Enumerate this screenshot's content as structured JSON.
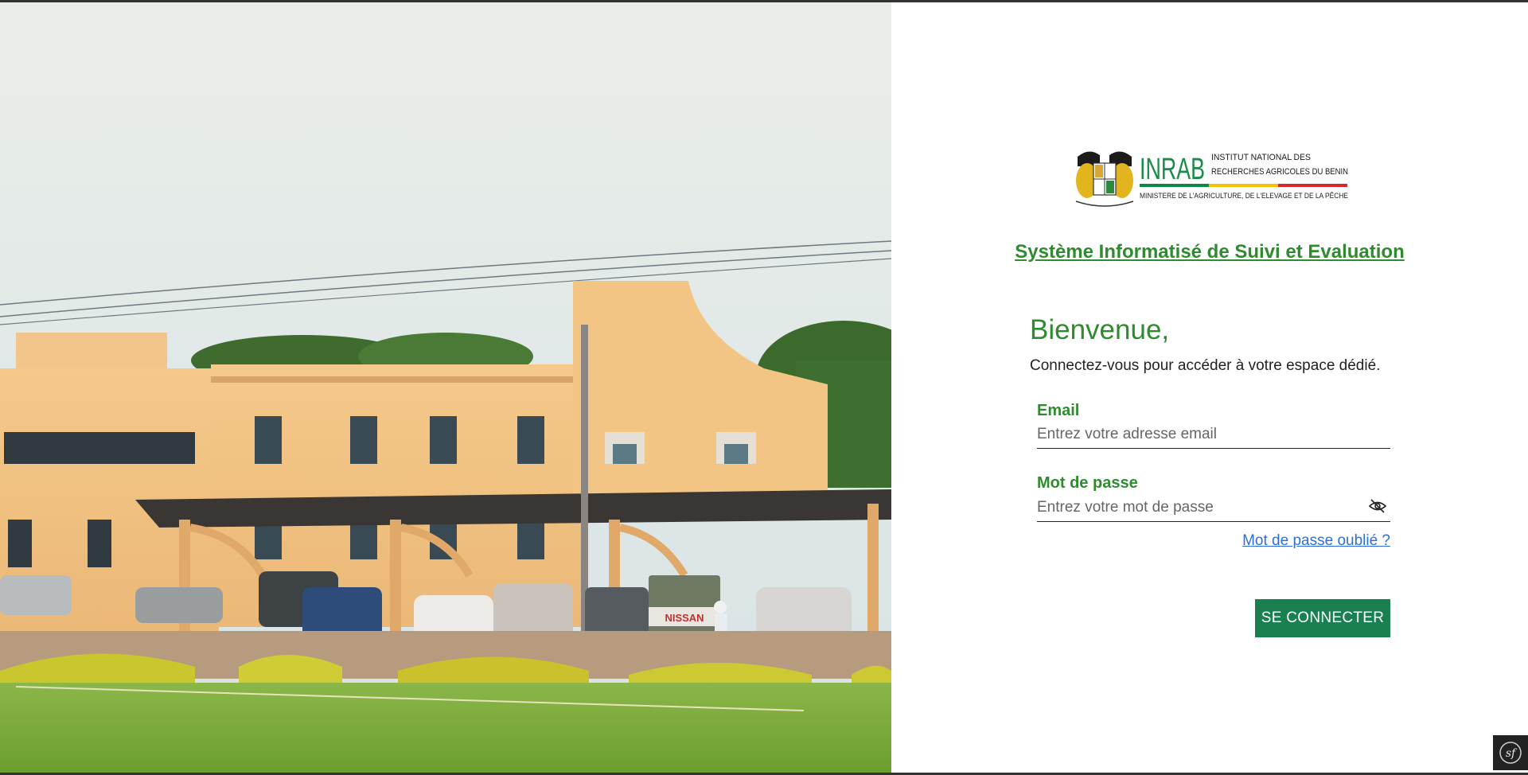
{
  "logo": {
    "acronym": "INRAB",
    "line1": "INSTITUT NATIONAL DES",
    "line2": "RECHERCHES AGRICOLES DU BENIN",
    "ministry": "MINISTERE DE L'AGRICULTURE, DE L'ELEVAGE  ET DE LA PÊCHE",
    "colors": {
      "green": "#0e8a47",
      "yellow": "#f2c400",
      "red": "#d62828"
    }
  },
  "app_title": "Système Informatisé de Suivi et Evaluation",
  "welcome": {
    "heading": "Bienvenue,",
    "subtitle": "Connectez-vous pour accéder à votre espace dédié."
  },
  "form": {
    "email_label": "Email",
    "email_placeholder": "Entrez votre adresse email",
    "password_label": "Mot de passe",
    "password_placeholder": "Entrez votre mot de passe",
    "toggle_icon": "eye-slash-icon",
    "forgot_link": "Mot de passe oublié ?",
    "submit_label": "SE CONNECTER"
  },
  "photo": {
    "truck_text": "NISSAN"
  },
  "colors": {
    "brand_green": "#2e8b2e",
    "button_green": "#1a8050",
    "link_blue": "#2a6fdb"
  },
  "toolbar": {
    "icon": "symfony-icon",
    "glyph": "sf"
  }
}
